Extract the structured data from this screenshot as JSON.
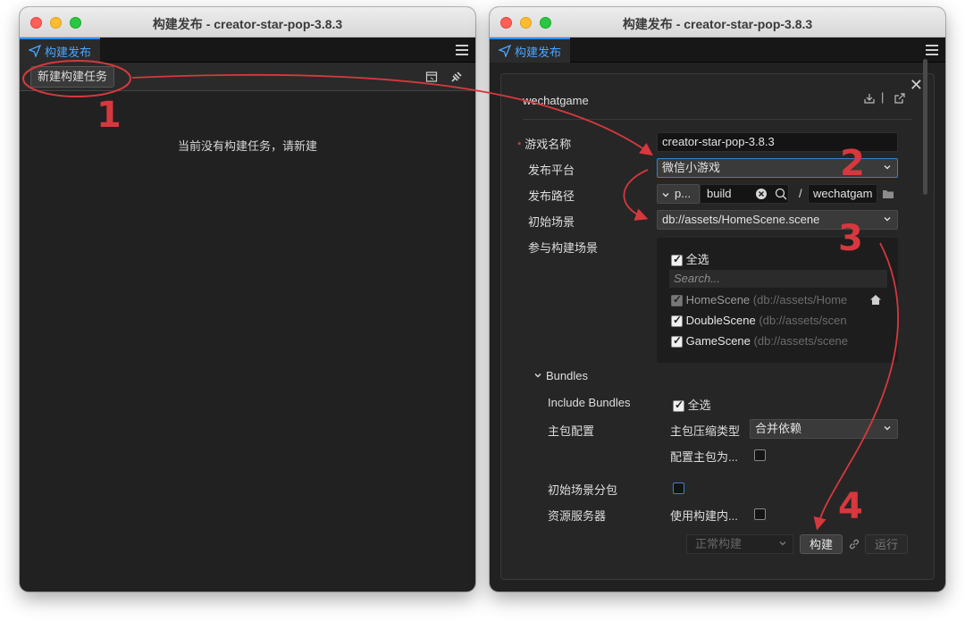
{
  "left_window": {
    "title": "构建发布 - creator-star-pop-3.8.3",
    "tab_label": "构建发布",
    "new_task_button": "新建构建任务",
    "empty_message": "当前没有构建任务，请新建"
  },
  "right_window": {
    "title": "构建发布 - creator-star-pop-3.8.3",
    "tab_label": "构建发布",
    "platform_title": "wechatgame",
    "form": {
      "game_name_label": "游戏名称",
      "game_name_value": "creator-star-pop-3.8.3",
      "platform_label": "发布平台",
      "platform_value": "微信小游戏",
      "path_label": "发布路径",
      "path_prefix": "p...",
      "path_dir": "build",
      "path_sep": "/",
      "path_name": "wechatgam",
      "start_scene_label": "初始场景",
      "start_scene_value": "db://assets/HomeScene.scene",
      "scenes_label": "参与构建场景",
      "select_all": "全选",
      "search_placeholder": "Search...",
      "scenes": [
        {
          "name": "HomeScene",
          "path": "(db://assets/Home"
        },
        {
          "name": "DoubleScene",
          "path": "(db://assets/scen"
        },
        {
          "name": "GameScene",
          "path": "(db://assets/scene"
        }
      ]
    },
    "bundles": {
      "header": "Bundles",
      "include_label": "Include Bundles",
      "include_value": "全选",
      "main_config_label": "主包配置",
      "compress_label": "主包压缩类型",
      "compress_value": "合并依赖",
      "config_main_label": "配置主包为...",
      "start_subpack_label": "初始场景分包",
      "res_server_label": "资源服务器",
      "use_build_label": "使用构建内..."
    },
    "footer": {
      "mode_value": "正常构建",
      "build_button": "构建",
      "run_button": "运行"
    }
  },
  "annotations": [
    "1",
    "2",
    "3",
    "4"
  ],
  "colors": {
    "accent": "#4aa6ff",
    "annotation": "#d6383e",
    "panel_bg": "#262626",
    "window_bg": "#212121"
  }
}
